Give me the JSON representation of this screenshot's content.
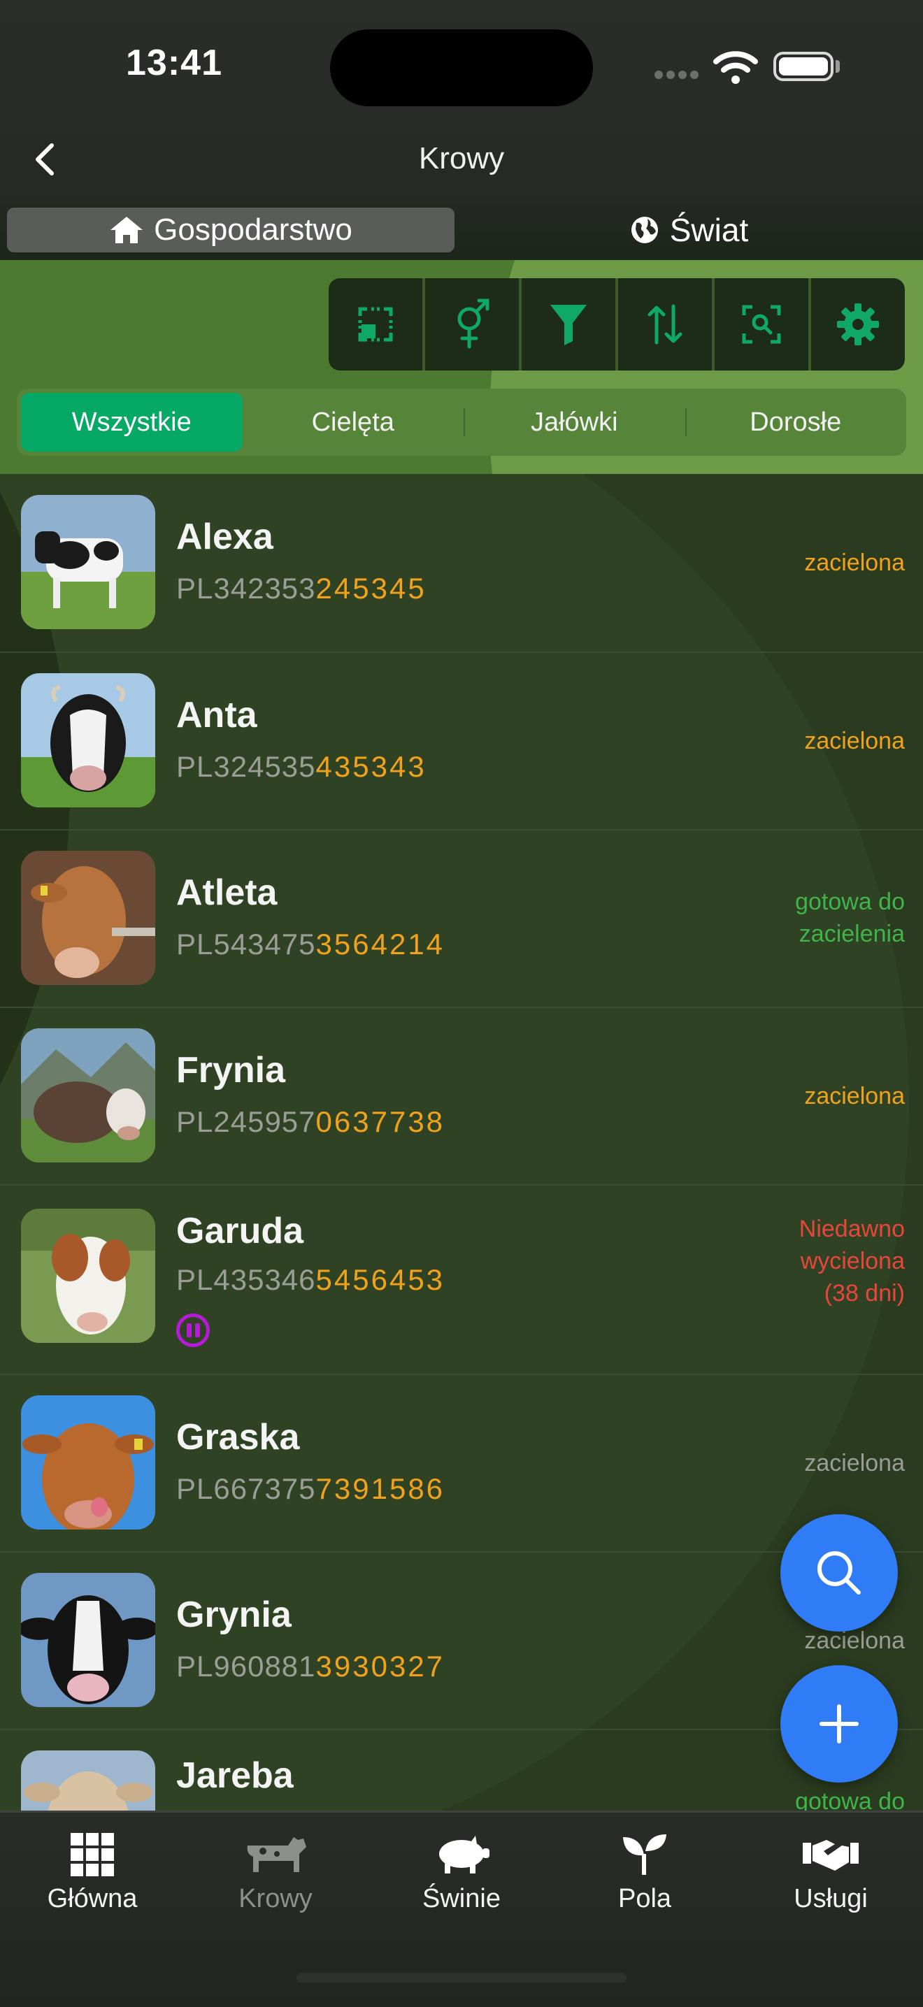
{
  "status_bar": {
    "time": "13:41"
  },
  "header": {
    "title": "Krowy",
    "back_icon": "chevron-left-icon"
  },
  "segments": [
    {
      "label": "Gospodarstwo",
      "icon": "home-icon",
      "selected": true
    },
    {
      "label": "Świat",
      "icon": "globe-icon",
      "selected": false
    }
  ],
  "toolbar": {
    "buttons": [
      "select-icon",
      "gender-icon",
      "filter-icon",
      "sort-icon",
      "scan-icon",
      "gear-icon"
    ]
  },
  "tabs": [
    {
      "label": "Wszystkie",
      "active": true
    },
    {
      "label": "Cielęta",
      "active": false
    },
    {
      "label": "Jałówki",
      "active": false
    },
    {
      "label": "Dorosłe",
      "active": false
    }
  ],
  "cows": [
    {
      "name": "Alexa",
      "id_prefix": "PL342353",
      "id_suffix": "245345",
      "status": "zacielona",
      "status_color": "#f0a21c"
    },
    {
      "name": "Anta",
      "id_prefix": "PL324535",
      "id_suffix": "435343",
      "status": "zacielona",
      "status_color": "#f0a21c"
    },
    {
      "name": "Atleta",
      "id_prefix": "PL543475",
      "id_suffix": "3564214",
      "status": "gotowa do zacielenia",
      "status_color": "#3fb44a"
    },
    {
      "name": "Frynia",
      "id_prefix": "PL245957",
      "id_suffix": "0637738",
      "status": "zacielona",
      "status_color": "#f0a21c"
    },
    {
      "name": "Garuda",
      "id_prefix": "PL435346",
      "id_suffix": "5456453",
      "status": "Niedawno wycielona (38 dni)",
      "status_color": "#e8463a",
      "paused": true
    },
    {
      "name": "Graska",
      "id_prefix": "PL667375",
      "id_suffix": "7391586",
      "status": "zacielona",
      "status_color": "#9a9e97"
    },
    {
      "name": "Grynia",
      "id_prefix": "PL960881",
      "id_suffix": "3930327",
      "status": "zacielona",
      "status_color": "#9a9e97"
    },
    {
      "name": "Jareba",
      "id_prefix": "",
      "id_suffix": "",
      "status": "gotowa do",
      "status_color": "#3fb44a"
    }
  ],
  "fabs": {
    "search_icon": "search-icon",
    "add_icon": "plus-icon"
  },
  "bottom_nav": [
    {
      "label": "Główna",
      "icon": "grid-icon",
      "active": true
    },
    {
      "label": "Krowy",
      "icon": "cow-icon",
      "active": false
    },
    {
      "label": "Świnie",
      "icon": "pig-icon",
      "active": true
    },
    {
      "label": "Pola",
      "icon": "sprout-icon",
      "active": true
    },
    {
      "label": "Usługi",
      "icon": "handshake-icon",
      "active": true
    }
  ]
}
